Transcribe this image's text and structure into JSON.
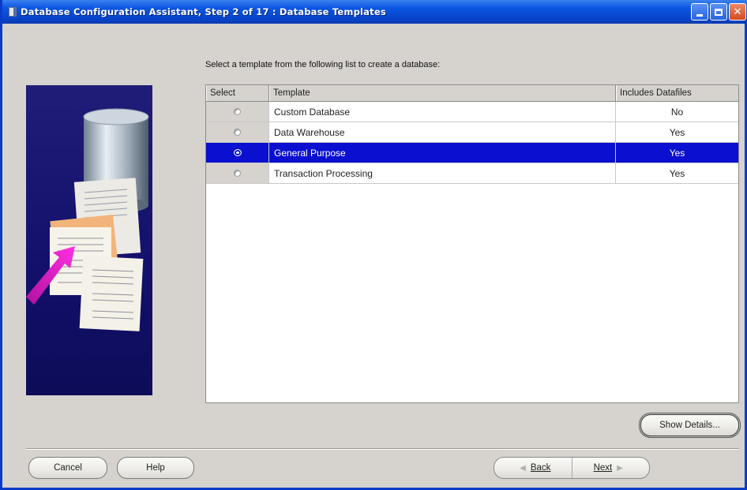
{
  "window": {
    "title": "Database Configuration Assistant, Step 2 of 17 : Database Templates",
    "buttons": [
      "minimize",
      "maximize",
      "close"
    ]
  },
  "instruction": "Select a template from the following list to create a database:",
  "table": {
    "headers": [
      "Select",
      "Template",
      "Includes Datafiles"
    ],
    "rows": [
      {
        "selected": false,
        "template": "Custom Database",
        "includes": "No"
      },
      {
        "selected": false,
        "template": "Data Warehouse",
        "includes": "Yes"
      },
      {
        "selected": true,
        "template": "General Purpose",
        "includes": "Yes"
      },
      {
        "selected": false,
        "template": "Transaction Processing",
        "includes": "Yes"
      }
    ]
  },
  "buttons": {
    "show_details": "Show Details...",
    "cancel": "Cancel",
    "help": "Help",
    "back": "Back",
    "next": "Next"
  },
  "colors": {
    "title_bar": "#0a55e0",
    "selection": "#0a0fd0",
    "illustration_bg": "#1f1d78",
    "arrow": "#e020c8"
  },
  "icons": {
    "illustration": [
      "database-cylinder-icon",
      "documents-icon",
      "arrow-icon"
    ],
    "nav": [
      "chevron-left-icon",
      "chevron-right-icon"
    ]
  }
}
